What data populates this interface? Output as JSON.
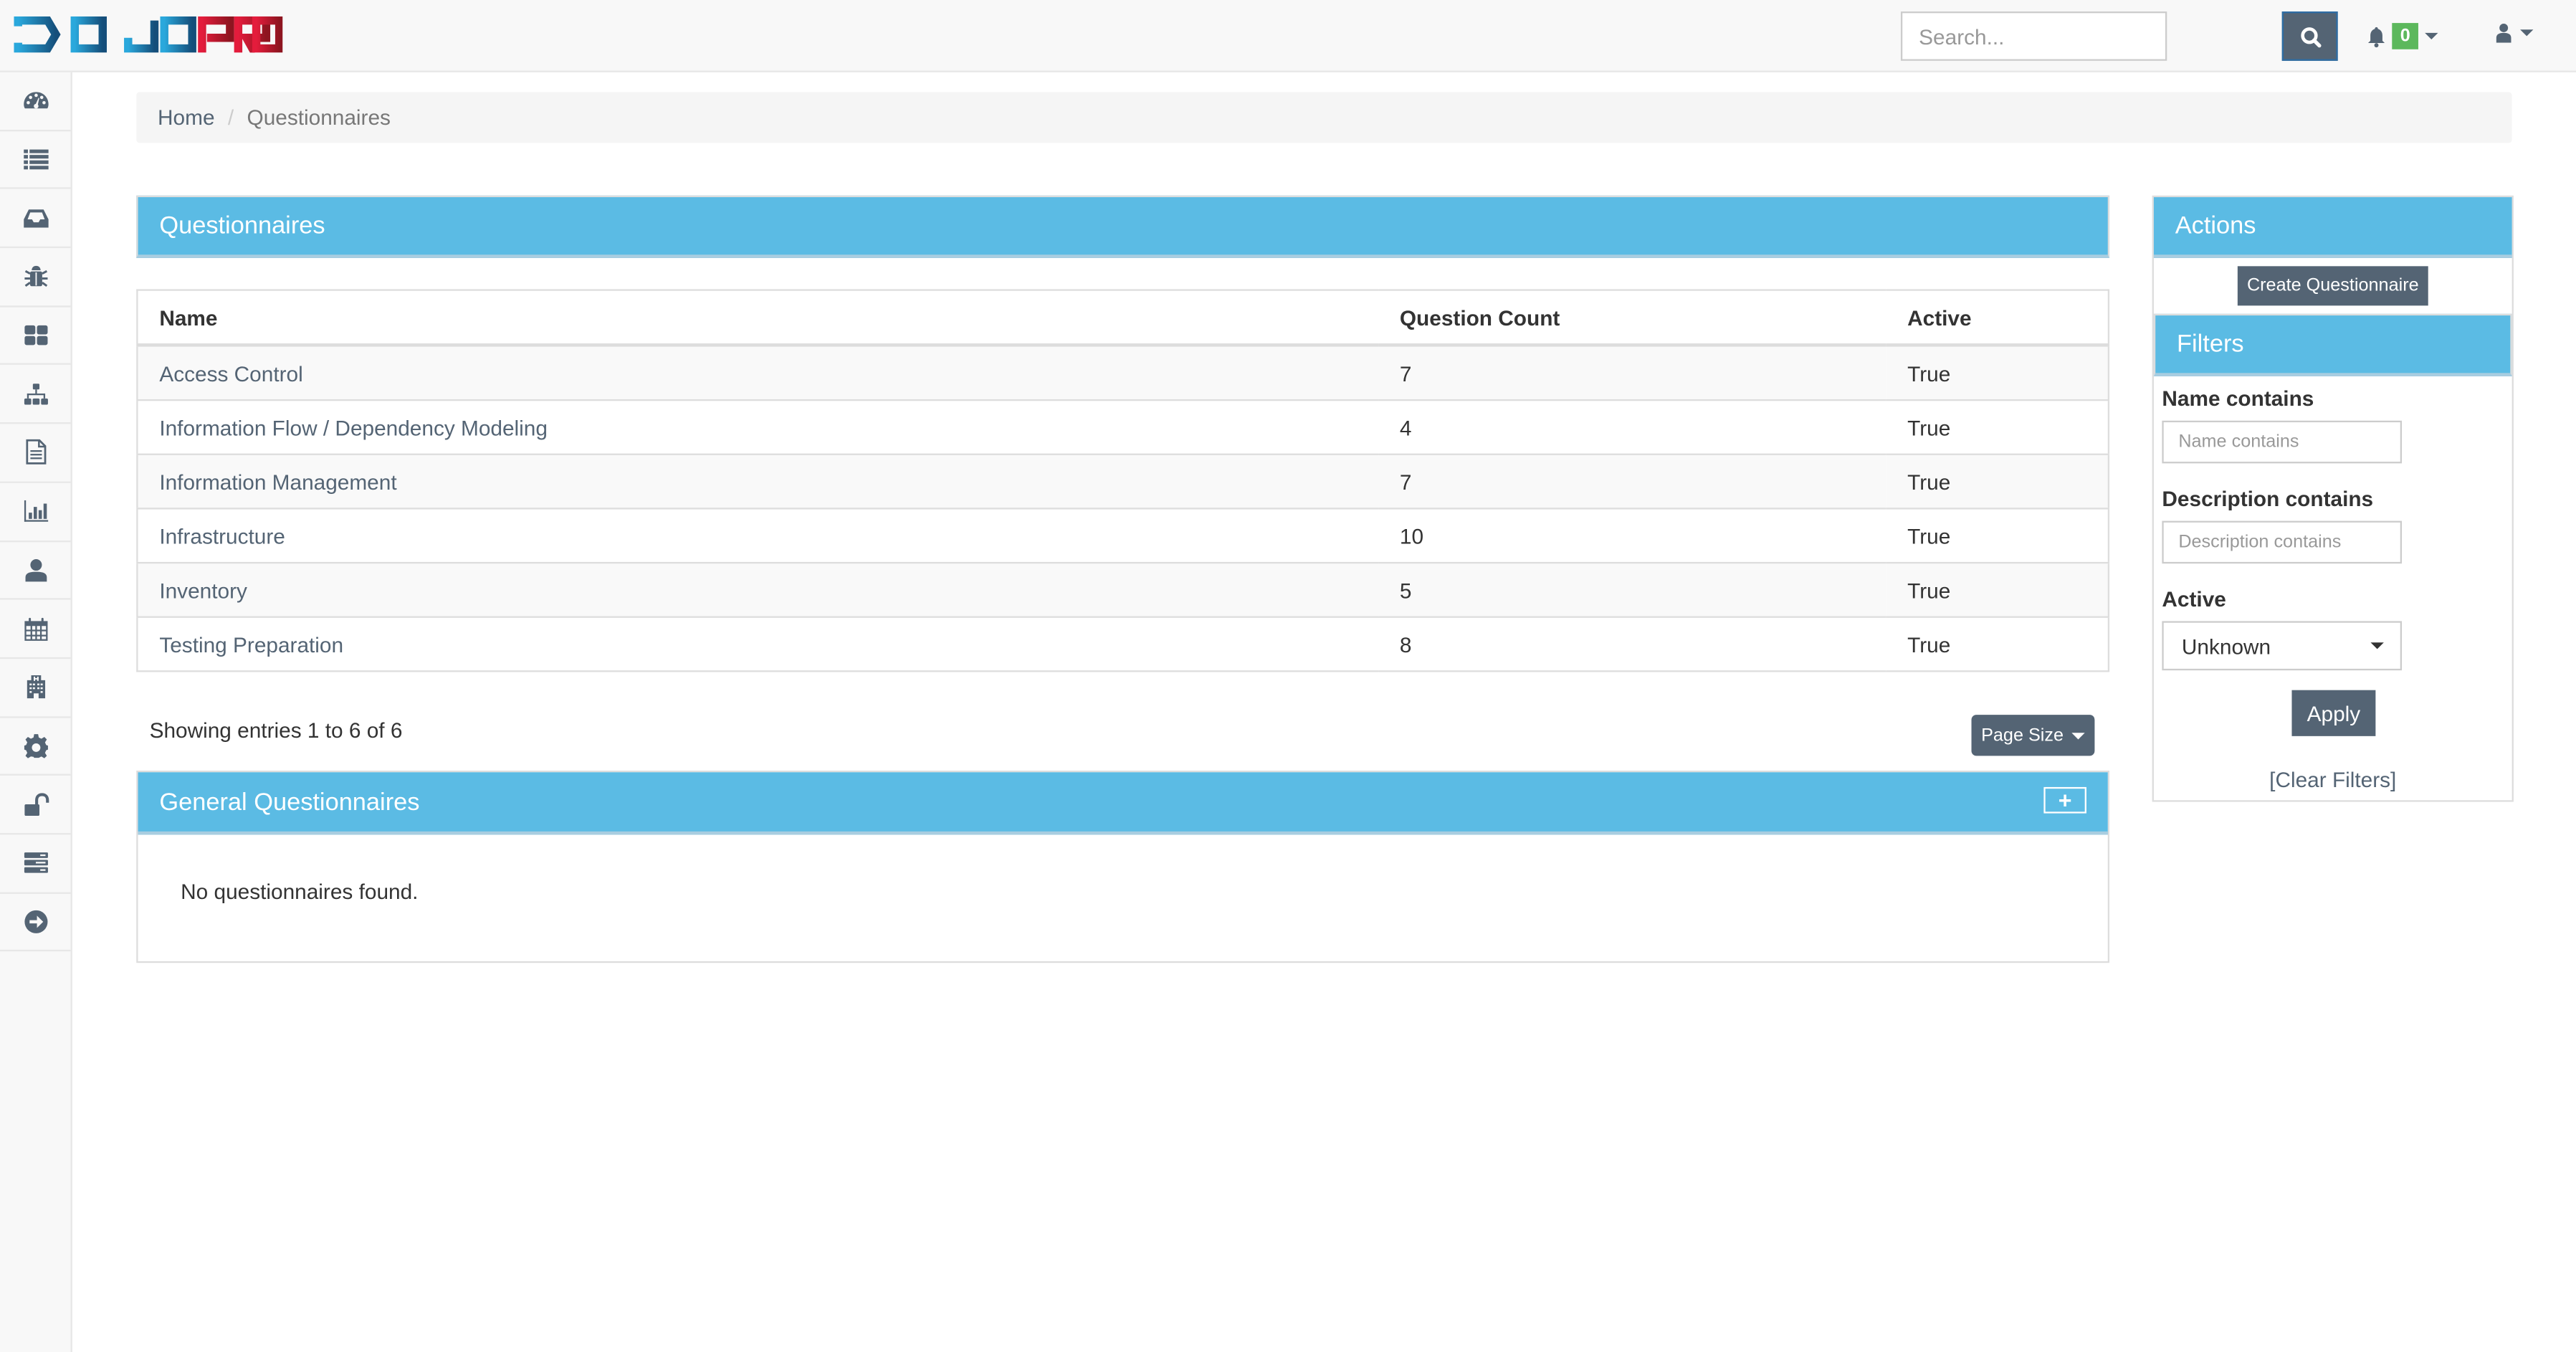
{
  "brand": {
    "part1": "DOJO",
    "part2": "PRO",
    "color1": "#1f7fb6",
    "color2": "#c8102e"
  },
  "navbar": {
    "search_placeholder": "Search...",
    "notification_count": "0"
  },
  "sidebar": {
    "items": [
      {
        "icon": "dashboard-icon"
      },
      {
        "icon": "list-icon"
      },
      {
        "icon": "inbox-icon"
      },
      {
        "icon": "bug-icon"
      },
      {
        "icon": "grid-icon"
      },
      {
        "icon": "sitemap-icon"
      },
      {
        "icon": "document-icon"
      },
      {
        "icon": "bar-chart-icon"
      },
      {
        "icon": "user-icon"
      },
      {
        "icon": "calendar-icon"
      },
      {
        "icon": "hospital-icon"
      },
      {
        "icon": "gear-icon"
      },
      {
        "icon": "unlock-icon"
      },
      {
        "icon": "server-icon"
      },
      {
        "icon": "arrow-circle-right-icon"
      }
    ]
  },
  "breadcrumb": {
    "home": "Home",
    "separator": "/",
    "current": "Questionnaires"
  },
  "questionnaires": {
    "title": "Questionnaires",
    "columns": [
      "Name",
      "Question Count",
      "Active"
    ],
    "rows": [
      {
        "name": "Access Control",
        "count": "7",
        "active": "True"
      },
      {
        "name": "Information Flow / Dependency Modeling",
        "count": "4",
        "active": "True"
      },
      {
        "name": "Information Management",
        "count": "7",
        "active": "True"
      },
      {
        "name": "Infrastructure",
        "count": "10",
        "active": "True"
      },
      {
        "name": "Inventory",
        "count": "5",
        "active": "True"
      },
      {
        "name": "Testing Preparation",
        "count": "8",
        "active": "True"
      }
    ],
    "showing": "Showing entries 1 to 6 of 6",
    "page_size_label": "Page Size"
  },
  "general": {
    "title": "General Questionnaires",
    "add_label": "+",
    "empty": "No questionnaires found."
  },
  "actions": {
    "title": "Actions",
    "create_label": "Create Questionnaire"
  },
  "filters": {
    "title": "Filters",
    "name_label": "Name contains",
    "name_placeholder": "Name contains",
    "desc_label": "Description contains",
    "desc_placeholder": "Description contains",
    "active_label": "Active",
    "active_value": "Unknown",
    "apply_label": "Apply",
    "clear_label": "[Clear Filters]"
  },
  "colors": {
    "panel_header": "#5bbbe4",
    "button": "#546474",
    "badge": "#5cb85c"
  }
}
